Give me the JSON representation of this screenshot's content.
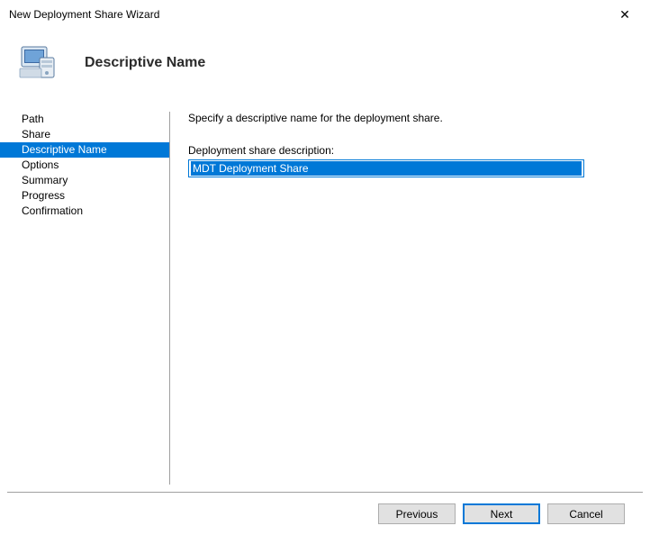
{
  "window": {
    "title": "New Deployment Share Wizard"
  },
  "header": {
    "page_title": "Descriptive Name"
  },
  "sidebar": {
    "items": [
      {
        "label": "Path",
        "selected": false
      },
      {
        "label": "Share",
        "selected": false
      },
      {
        "label": "Descriptive Name",
        "selected": true
      },
      {
        "label": "Options",
        "selected": false
      },
      {
        "label": "Summary",
        "selected": false
      },
      {
        "label": "Progress",
        "selected": false
      },
      {
        "label": "Confirmation",
        "selected": false
      }
    ]
  },
  "main": {
    "instruction": "Specify a descriptive name for the deployment share.",
    "field_label": "Deployment share description:",
    "field_value": "MDT Deployment Share"
  },
  "footer": {
    "previous": "Previous",
    "next": "Next",
    "cancel": "Cancel"
  }
}
